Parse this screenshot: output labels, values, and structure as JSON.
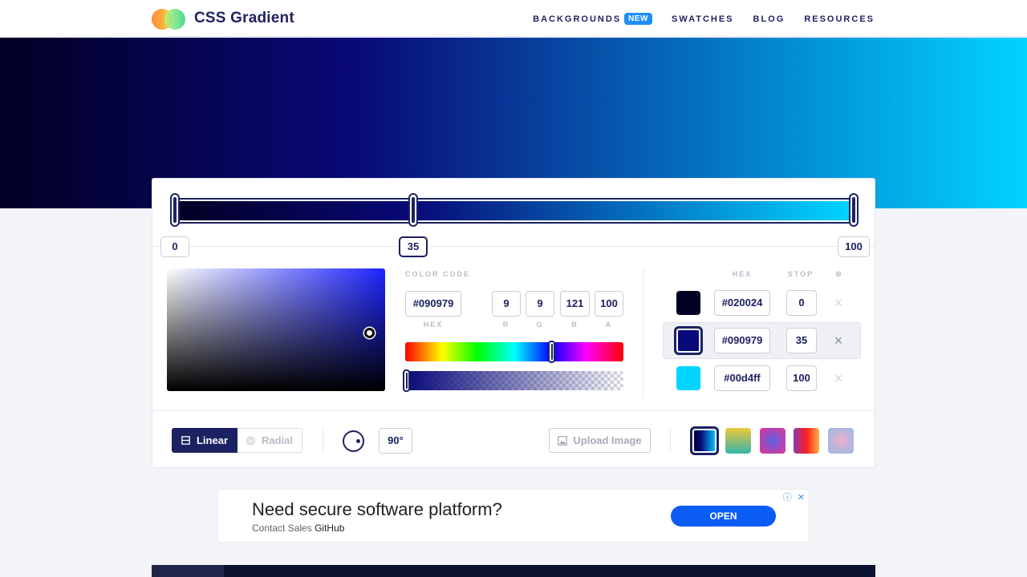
{
  "header": {
    "brand": "CSS Gradient",
    "nav": [
      {
        "label": "BACKGROUNDS",
        "badge": "NEW"
      },
      {
        "label": "SWATCHES"
      },
      {
        "label": "BLOG"
      },
      {
        "label": "RESOURCES"
      }
    ]
  },
  "gradient": {
    "stops": [
      {
        "hex": "#020024",
        "stop": "0"
      },
      {
        "hex": "#090979",
        "stop": "35"
      },
      {
        "hex": "#00d4ff",
        "stop": "100"
      }
    ],
    "active_stop_index": 1
  },
  "color_code": {
    "label": "COLOR CODE",
    "hex": "#090979",
    "r": "9",
    "g": "9",
    "b": "121",
    "a": "100",
    "hex_label": "HEX",
    "r_label": "R",
    "g_label": "G",
    "b_label": "B",
    "a_label": "A",
    "hue_position": 0.67,
    "alpha_position": 0.0
  },
  "stops_table": {
    "hex_header": "HEX",
    "stop_header": "STOP",
    "add_icon": "⊕",
    "remove_icon": "×"
  },
  "toolbar": {
    "linear_label": "Linear",
    "radial_label": "Radial",
    "angle": "90°",
    "upload_label": "Upload Image"
  },
  "presets": [
    "linear-gradient(90deg,#020024,#090979 35%,#00d4ff)",
    "linear-gradient(180deg,#f0c83b,#35b6a8)",
    "radial-gradient(circle,#5a63e8,#e8318f)",
    "linear-gradient(90deg,#833ab4,#fd1d1d 50%,#fcb045)",
    "radial-gradient(circle,#eeaeca,#94bbe9)"
  ],
  "ad": {
    "title": "Need secure software platform?",
    "subtitle": "Contact Sales",
    "advertiser": "GitHub",
    "button": "OPEN",
    "icons": "ⓘ ✕"
  },
  "colors": {
    "accent": "#1c2261",
    "badge": "#1e8ef7",
    "ad_button": "#0a5cf5"
  }
}
